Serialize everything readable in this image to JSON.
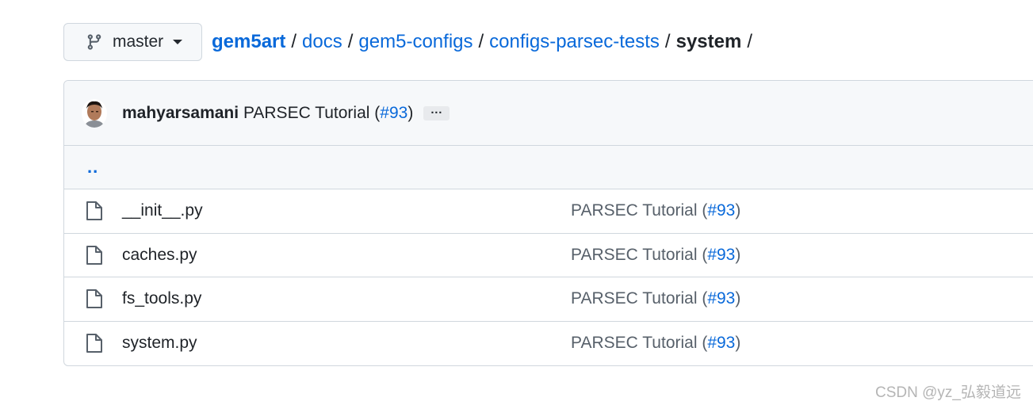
{
  "branch": {
    "name": "master",
    "icon": "git-branch-icon"
  },
  "breadcrumb": {
    "root": "gem5art",
    "segments": [
      "docs",
      "gem5-configs",
      "configs-parsec-tests"
    ],
    "current": "system",
    "separator": "/"
  },
  "commit": {
    "author": "mahyarsamani",
    "message": "PARSEC Tutorial (",
    "pr": "#93",
    "close": ")",
    "ellipsis": "···"
  },
  "up_dir": "..",
  "files": [
    {
      "name": "__init__.py",
      "msg": "PARSEC Tutorial (",
      "pr": "#93",
      "close": ")"
    },
    {
      "name": "caches.py",
      "msg": "PARSEC Tutorial (",
      "pr": "#93",
      "close": ")"
    },
    {
      "name": "fs_tools.py",
      "msg": "PARSEC Tutorial (",
      "pr": "#93",
      "close": ")"
    },
    {
      "name": "system.py",
      "msg": "PARSEC Tutorial (",
      "pr": "#93",
      "close": ")"
    }
  ],
  "watermark": "CSDN @yz_弘毅道远",
  "colors": {
    "link": "#0969da",
    "muted": "#57606a",
    "border": "#d0d7de",
    "header_bg": "#f6f8fa"
  }
}
